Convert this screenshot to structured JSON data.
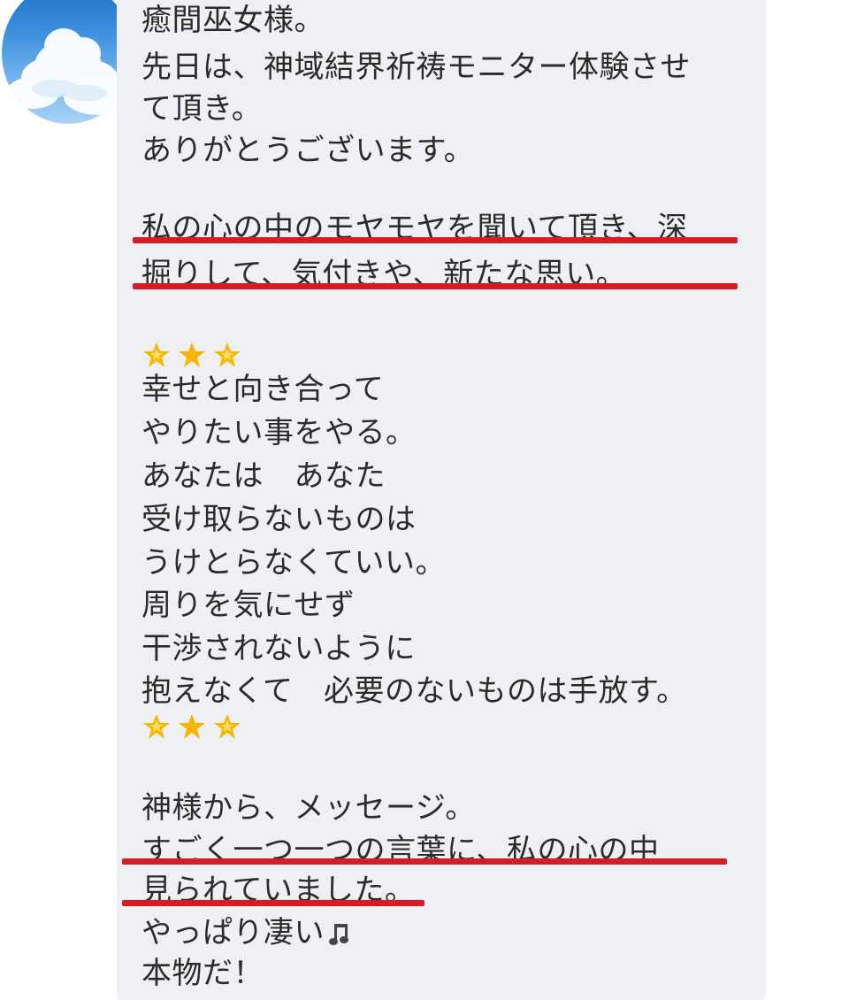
{
  "message": {
    "lines": [
      "癒間巫女様。",
      "先日は、神域結界祈祷モニター体験させ",
      "て頂き。",
      "ありがとうございます。",
      "私の心の中のモヤモヤを聞いて頂き、深",
      "掘りして、気付きや、新たな思い。",
      "幸せと向き合って",
      "やりたい事をやる。",
      "あなたは　あなた",
      "受け取らないものは",
      "うけとらなくていい。",
      "周りを気にせず",
      "干渉されないように",
      "抱えなくて　必要のないものは手放す。",
      "神様から、メッセージ。",
      "すごく一つ一つの言葉に、私の心の中",
      "見られていました。",
      "やっぱり凄い",
      "本物だ！"
    ]
  },
  "icons": {
    "star_glow": "glowing-star",
    "star": "star",
    "music_note": "music-note"
  },
  "colors": {
    "bubble": "#eef0f3",
    "text": "#2b2b2b",
    "underline": "#d41d24",
    "star": "#f5b800"
  }
}
